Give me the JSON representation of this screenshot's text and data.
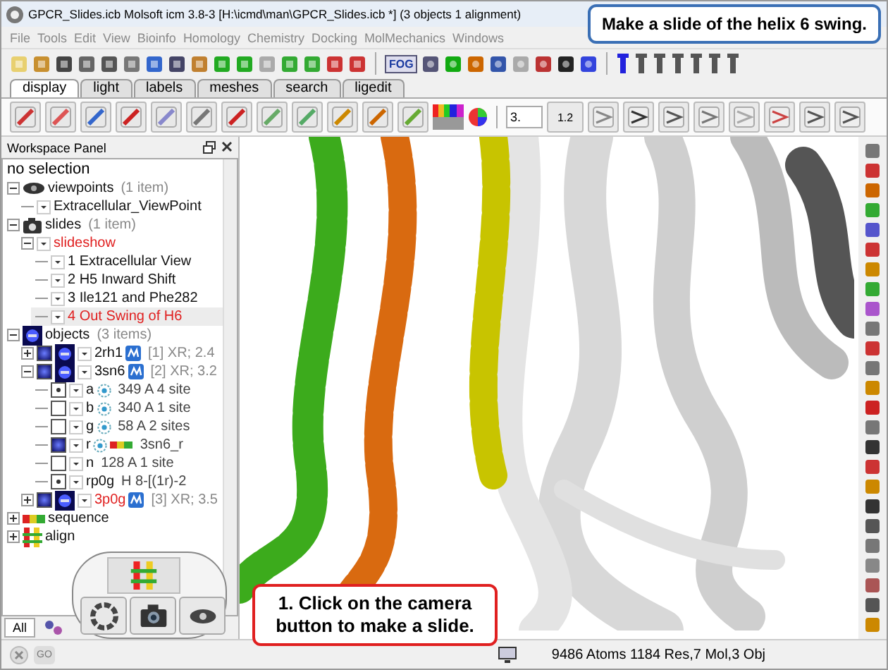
{
  "window": {
    "title": "GPCR_Slides.icb Molsoft icm 3.8-3  [H:\\icmd\\man\\GPCR_Slides.icb *] (3 objects 1 alignment)"
  },
  "menu": [
    "File",
    "Tools",
    "Edit",
    "View",
    "Bioinfo",
    "Homology",
    "Chemistry",
    "Docking",
    "MolMechanics",
    "Windows"
  ],
  "tabs": [
    {
      "label": "display",
      "selected": true
    },
    {
      "label": "light",
      "selected": false
    },
    {
      "label": "labels",
      "selected": false
    },
    {
      "label": "meshes",
      "selected": false
    },
    {
      "label": "search",
      "selected": false
    },
    {
      "label": "ligedit",
      "selected": false
    }
  ],
  "toolbar": {
    "value_field": "3.",
    "fog_label": "FOG",
    "distance_label": "1.2"
  },
  "workspace_panel": {
    "title": "Workspace Panel",
    "header": "no selection",
    "tree": [
      {
        "kind": "viewpoints",
        "label": "viewpoints",
        "info": "(1 item)",
        "expanded": true,
        "current": false,
        "children": [
          {
            "kind": "viewpoint",
            "label": "Extracellular_ViewPoint",
            "current": false
          }
        ]
      },
      {
        "kind": "slides",
        "label": "slides",
        "info": "(1 item)",
        "expanded": true,
        "current": false,
        "children": [
          {
            "kind": "slideshow",
            "label": "slideshow",
            "expanded": true,
            "current": true,
            "children": [
              {
                "kind": "slide",
                "label": "1 Extracellular View",
                "selected": false,
                "current": false
              },
              {
                "kind": "slide",
                "label": "2 H5 Inward Shift",
                "selected": false,
                "current": false
              },
              {
                "kind": "slide",
                "label": "3 Ile121 and Phe282",
                "selected": false,
                "current": false
              },
              {
                "kind": "slide",
                "label": "4 Out Swing of H6",
                "selected": true,
                "current": true
              }
            ]
          }
        ]
      },
      {
        "kind": "objects",
        "label": "objects",
        "info": "(3 items)",
        "expanded": true,
        "current": false,
        "children": [
          {
            "kind": "object",
            "label": "2rh1",
            "info": "[1] XR; 2.4",
            "expanded": false,
            "current": false,
            "checked": true
          },
          {
            "kind": "object",
            "label": "3sn6",
            "info": "[2] XR; 3.2",
            "expanded": true,
            "current": false,
            "checked": true,
            "children": [
              {
                "kind": "chain",
                "label": "a",
                "info": "349 A  4 site",
                "checked": true,
                "partial": true,
                "current": false,
                "badge": true
              },
              {
                "kind": "chain",
                "label": "b",
                "info": "340 A  1 site",
                "checked": false,
                "current": false,
                "badge": true
              },
              {
                "kind": "chain",
                "label": "g",
                "info": "58 A  2 sites",
                "checked": false,
                "current": false,
                "badge": true
              },
              {
                "kind": "chain",
                "label": "r",
                "info": "3sn6_r",
                "checked": true,
                "partial": false,
                "current": false,
                "badge": true
              },
              {
                "kind": "chain",
                "label": "n",
                "info": "128 A  1 site",
                "checked": false,
                "current": false,
                "badge": false
              },
              {
                "kind": "chain",
                "label": "rp0g",
                "info": "H  8-[(1r)-2",
                "checked": true,
                "partial": true,
                "current": false,
                "badge": false
              }
            ]
          },
          {
            "kind": "object",
            "label": "3p0g",
            "info": "[3] XR; 3.5",
            "expanded": false,
            "current": true,
            "checked": true
          }
        ]
      },
      {
        "kind": "sequences",
        "label": "sequence",
        "expanded": false,
        "current": false
      },
      {
        "kind": "alignments",
        "label": "align",
        "expanded": false,
        "current": false
      }
    ],
    "bottom_tabs": [
      {
        "label": "All",
        "selected": true
      }
    ]
  },
  "status_bar": {
    "go_label": "GO",
    "text": "9486 Atoms 1184 Res,7 Mol,3 Obj"
  },
  "callouts": [
    {
      "kind": "top",
      "text": "Make a slide of the helix 6 swing."
    },
    {
      "kind": "bottom",
      "text": "1. Click on the camera button to make a slide."
    }
  ]
}
